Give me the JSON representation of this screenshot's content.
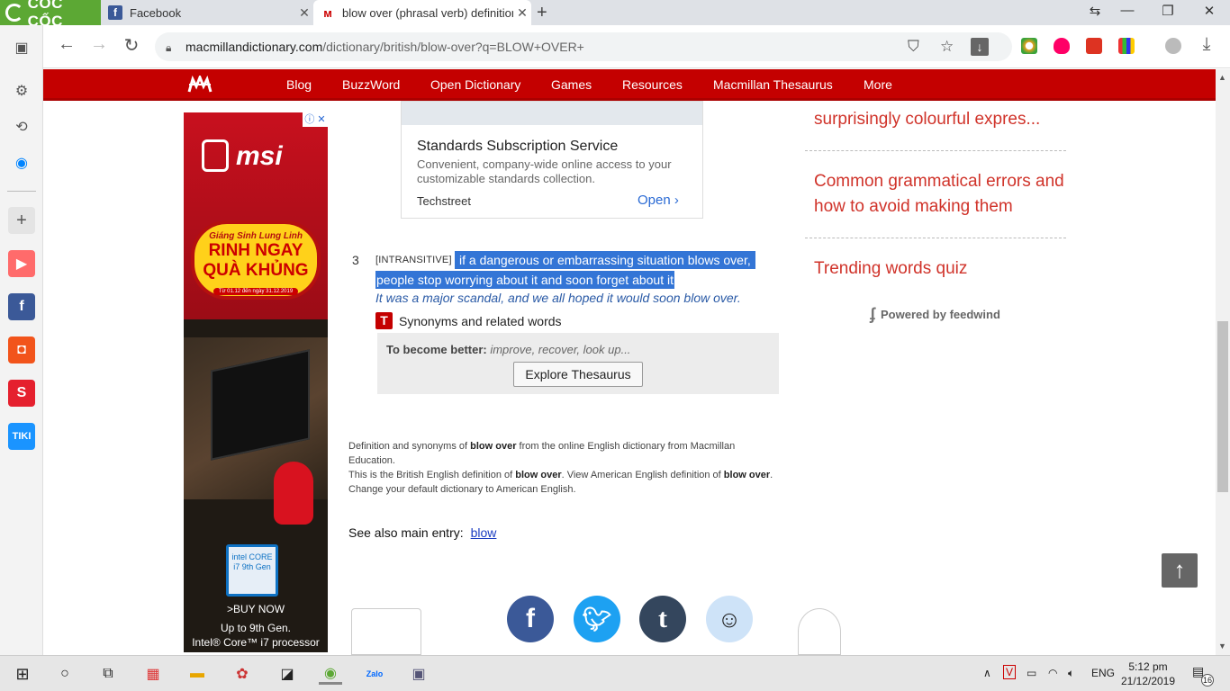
{
  "browser": {
    "brand": "CỐC CỐC",
    "tabs": [
      {
        "title": "Facebook"
      },
      {
        "title": "blow over (phrasal verb) definition"
      }
    ],
    "url_host": "macmillandictionary.com",
    "url_path": "/dictionary/british/blow-over?q=BLOW+OVER+"
  },
  "site_nav": {
    "links": [
      "Blog",
      "BuzzWord",
      "Open Dictionary",
      "Games",
      "Resources",
      "Macmillan Thesaurus",
      "More"
    ]
  },
  "ad_card": {
    "title": "Standards Subscription Service",
    "description": "Convenient, company-wide online access to your customizable standards collection.",
    "source": "Techstreet",
    "cta": "Open"
  },
  "side_ad": {
    "brand": "msi",
    "promo_line1": "Giáng Sinh Lung Linh",
    "promo_line2": "RINH NGAY",
    "promo_line3": "QUÀ KHỦNG",
    "promo_dates": "Từ 01.12 đến ngày 31.12.2019",
    "intel_badge": "intel CORE i7 9th Gen",
    "buy": ">BUY NOW",
    "tagline1": "Up to 9th Gen.",
    "tagline2": "Intel® Core™ i7 processor"
  },
  "definition": {
    "number": "3",
    "grammar": "[INTRANSITIVE]",
    "text_line1": "if a dangerous or embarrassing situation blows over,",
    "text_line2": "people stop worrying about it and soon forget about it",
    "example": "It was a major scandal, and we all hoped it would soon blow over.",
    "synonyms_label": "Synonyms and related words",
    "thesaurus_prefix": "To become better:",
    "thesaurus_words": "improve, recover, look up...",
    "thesaurus_button": "Explore Thesaurus"
  },
  "footnote": {
    "l1a": "Definition and synonyms of ",
    "l1b": "blow over",
    "l1c": " from the online English dictionary from Macmillan Education.",
    "l2a": "This is the British English definition of ",
    "l2b": "blow over",
    "l2c": ". View American English definition of ",
    "l2d": "blow over",
    "l2e": ".",
    "l3": "Change your default dictionary to American English."
  },
  "see_also": {
    "label": "See also main entry:",
    "link": "blow"
  },
  "right_col": {
    "links": [
      "surprisingly colourful expres...",
      "Common grammatical errors and how to avoid making them",
      "Trending words quiz"
    ],
    "powered_by": "Powered by feedwind"
  },
  "taskbar": {
    "lang": "ENG",
    "time": "5:12 pm",
    "date": "21/12/2019",
    "notif_count": "16"
  },
  "colors": {
    "brand_red": "#c40000",
    "link_red": "#d0332a",
    "selection": "#3375d6"
  }
}
